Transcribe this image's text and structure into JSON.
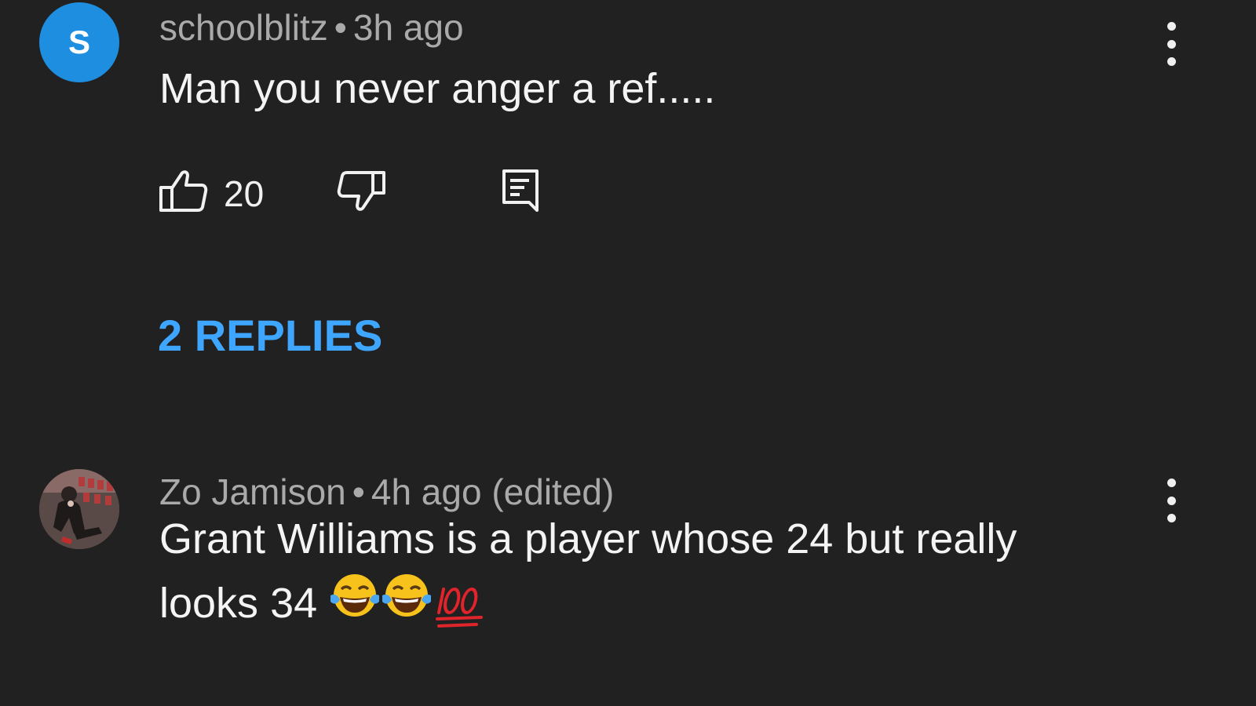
{
  "comments": [
    {
      "avatar_letter": "S",
      "author": "schoolblitz",
      "separator": "•",
      "time": "3h ago",
      "text": "Man you never anger a ref.....",
      "like_count": "20",
      "replies_label": "2 REPLIES",
      "icons": [
        "thumbs-up-icon",
        "thumbs-down-icon",
        "reply-icon",
        "more-vert-icon"
      ]
    },
    {
      "author": "Zo Jamison",
      "separator": "•",
      "time": "4h ago (edited)",
      "text_line1": "Grant Williams is a player whose 24 but really",
      "text_line2": "looks 34",
      "emojis": [
        "face-with-tears-of-joy",
        "face-with-tears-of-joy",
        "hundred-points"
      ],
      "icons": [
        "more-vert-icon"
      ]
    }
  ],
  "colors": {
    "background": "#212121",
    "avatar_blue": "#1e8fe0",
    "link_blue": "#3ea6ff",
    "meta_gray": "#aaaaaa"
  }
}
